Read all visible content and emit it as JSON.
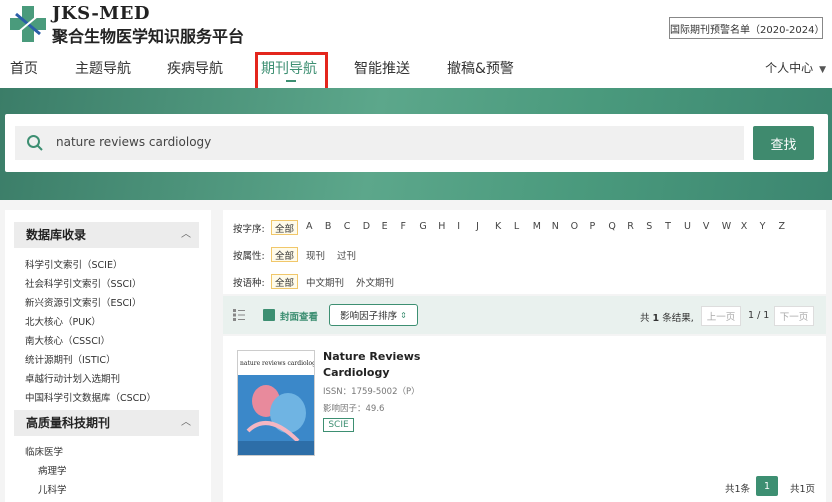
{
  "brand": {
    "name_en": "JKS-MED",
    "name_cn": "聚合生物医学知识服务平台"
  },
  "header": {
    "warning_list": "国际期刊预警名单（2020-2024）",
    "user_menu": "个人中心"
  },
  "nav": [
    "首页",
    "主题导航",
    "疾病导航",
    "期刊导航",
    "智能推送",
    "撤稿&预警"
  ],
  "search": {
    "value": "nature reviews cardiology",
    "button": "查找"
  },
  "sidebar": {
    "db_title": "数据库收录",
    "db_items": [
      "科学引文索引（SCIE）",
      "社会科学引文索引（SSCI）",
      "新兴资源引文索引（ESCI）",
      "北大核心（PUK）",
      "南大核心（CSSCI）",
      "统计源期刊（ISTIC）",
      "卓越行动计划入选期刊",
      "中国科学引文数据库（CSCD）"
    ],
    "hq_title": "高质量科技期刊",
    "hq_items": [
      "临床医学",
      "病理学",
      "儿科学"
    ]
  },
  "filters": {
    "alpha_label": "按字序:",
    "all": "全部",
    "letters": [
      "A",
      "B",
      "C",
      "D",
      "E",
      "F",
      "G",
      "H",
      "I",
      "J",
      "K",
      "L",
      "M",
      "N",
      "O",
      "P",
      "Q",
      "R",
      "S",
      "T",
      "U",
      "V",
      "W",
      "X",
      "Y",
      "Z"
    ],
    "attr_label": "按属性:",
    "attr_opts": [
      "现刊",
      "过刊"
    ],
    "lang_label": "按语种:",
    "lang_opts": [
      "中文期刊",
      "外文期刊"
    ]
  },
  "toolbar": {
    "cover_view": "封面查看",
    "sort": "影响因子排序",
    "result_prefix": "共",
    "result_count": "1",
    "result_suffix": "条结果,",
    "prev": "上一页",
    "page_info": "1 / 1",
    "next": "下一页"
  },
  "result": {
    "title": "Nature Reviews Cardiology",
    "issn": "ISSN：1759-5002（P）",
    "impact": "影响因子：49.6",
    "badge": "SCIE"
  },
  "pagination": {
    "total": "共1条",
    "current": "1",
    "pages": "共1页"
  },
  "colors": {
    "accent": "#3d8f72",
    "highlight": "#e3261d"
  }
}
